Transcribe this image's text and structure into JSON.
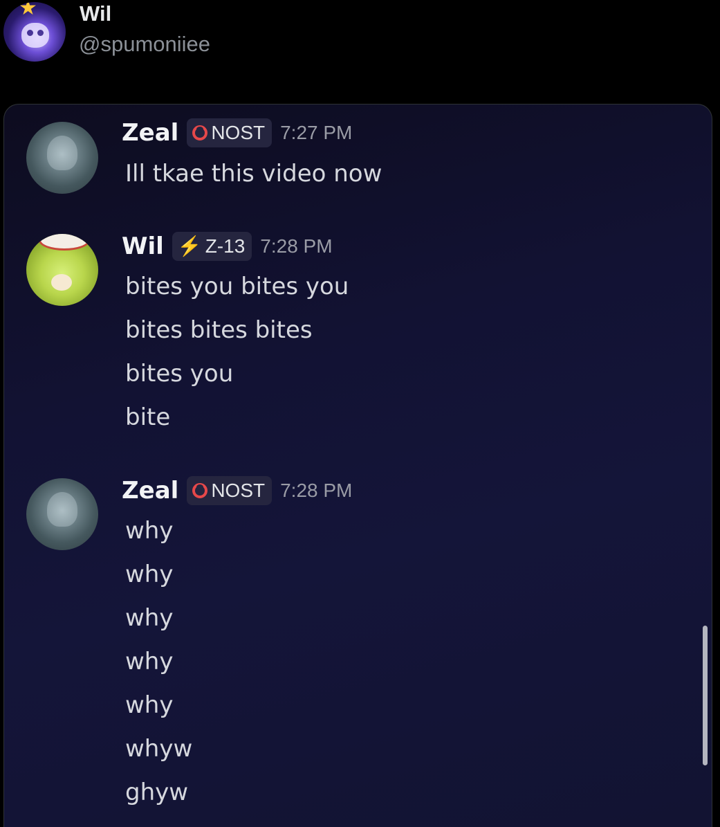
{
  "post": {
    "author_name": "Wil",
    "author_handle": "@spumoniiee"
  },
  "chat": {
    "messages": [
      {
        "username": "Zeal",
        "tag": "NOST",
        "tag_icon": "red-ring-icon",
        "time": "7:27 PM",
        "lines": [
          "Ill tkae this video now"
        ]
      },
      {
        "username": "Wil",
        "tag": "Z-13",
        "tag_icon": "lightning-icon",
        "time": "7:28 PM",
        "lines": [
          "bites you bites you",
          "bites bites bites",
          "bites you",
          "bite"
        ]
      },
      {
        "username": "Zeal",
        "tag": "NOST",
        "tag_icon": "red-ring-icon",
        "time": "7:28 PM",
        "lines": [
          "why",
          "why",
          "why",
          "why",
          "why",
          "whyw",
          "ghyw"
        ]
      }
    ]
  },
  "colors": {
    "page_background": "#000000",
    "chat_background": "#121233",
    "username": "#f2f3f5",
    "message_text": "#d6d8de",
    "timestamp": "#9a9ca6",
    "nost_icon": "#e6484a"
  }
}
